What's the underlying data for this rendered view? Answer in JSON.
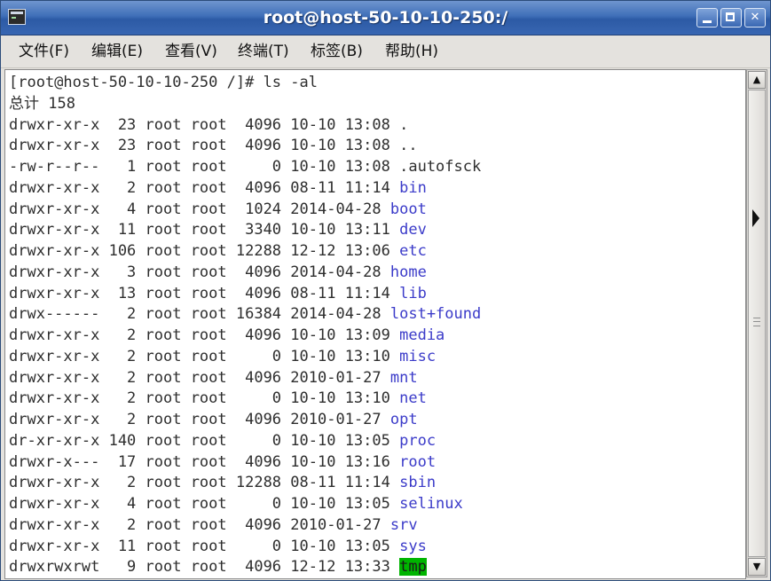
{
  "window": {
    "title": "root@host-50-10-10-250:/"
  },
  "menu": [
    "文件(F)",
    "编辑(E)",
    "查看(V)",
    "终端(T)",
    "标签(B)",
    "帮助(H)"
  ],
  "terminal": {
    "prompt": "[root@host-50-10-10-250 /]# ls -al",
    "total": "总计 158",
    "listing": [
      {
        "perm": "drwxr-xr-x",
        "links": "23",
        "owner": "root",
        "group": "root",
        "size": "4096",
        "date": "10-10 13:08",
        "name": ".",
        "kind": "plain"
      },
      {
        "perm": "drwxr-xr-x",
        "links": "23",
        "owner": "root",
        "group": "root",
        "size": "4096",
        "date": "10-10 13:08",
        "name": "..",
        "kind": "plain"
      },
      {
        "perm": "-rw-r--r--",
        "links": "1",
        "owner": "root",
        "group": "root",
        "size": "0",
        "date": "10-10 13:08",
        "name": ".autofsck",
        "kind": "plain"
      },
      {
        "perm": "drwxr-xr-x",
        "links": "2",
        "owner": "root",
        "group": "root",
        "size": "4096",
        "date": "08-11 11:14",
        "name": "bin",
        "kind": "dir"
      },
      {
        "perm": "drwxr-xr-x",
        "links": "4",
        "owner": "root",
        "group": "root",
        "size": "1024",
        "date": "2014-04-28",
        "name": "boot",
        "kind": "dir"
      },
      {
        "perm": "drwxr-xr-x",
        "links": "11",
        "owner": "root",
        "group": "root",
        "size": "3340",
        "date": "10-10 13:11",
        "name": "dev",
        "kind": "dir"
      },
      {
        "perm": "drwxr-xr-x",
        "links": "106",
        "owner": "root",
        "group": "root",
        "size": "12288",
        "date": "12-12 13:06",
        "name": "etc",
        "kind": "dir"
      },
      {
        "perm": "drwxr-xr-x",
        "links": "3",
        "owner": "root",
        "group": "root",
        "size": "4096",
        "date": "2014-04-28",
        "name": "home",
        "kind": "dir"
      },
      {
        "perm": "drwxr-xr-x",
        "links": "13",
        "owner": "root",
        "group": "root",
        "size": "4096",
        "date": "08-11 11:14",
        "name": "lib",
        "kind": "dir"
      },
      {
        "perm": "drwx------",
        "links": "2",
        "owner": "root",
        "group": "root",
        "size": "16384",
        "date": "2014-04-28",
        "name": "lost+found",
        "kind": "dir"
      },
      {
        "perm": "drwxr-xr-x",
        "links": "2",
        "owner": "root",
        "group": "root",
        "size": "4096",
        "date": "10-10 13:09",
        "name": "media",
        "kind": "dir"
      },
      {
        "perm": "drwxr-xr-x",
        "links": "2",
        "owner": "root",
        "group": "root",
        "size": "0",
        "date": "10-10 13:10",
        "name": "misc",
        "kind": "dir"
      },
      {
        "perm": "drwxr-xr-x",
        "links": "2",
        "owner": "root",
        "group": "root",
        "size": "4096",
        "date": "2010-01-27",
        "name": "mnt",
        "kind": "dir"
      },
      {
        "perm": "drwxr-xr-x",
        "links": "2",
        "owner": "root",
        "group": "root",
        "size": "0",
        "date": "10-10 13:10",
        "name": "net",
        "kind": "dir"
      },
      {
        "perm": "drwxr-xr-x",
        "links": "2",
        "owner": "root",
        "group": "root",
        "size": "4096",
        "date": "2010-01-27",
        "name": "opt",
        "kind": "dir"
      },
      {
        "perm": "dr-xr-xr-x",
        "links": "140",
        "owner": "root",
        "group": "root",
        "size": "0",
        "date": "10-10 13:05",
        "name": "proc",
        "kind": "dir"
      },
      {
        "perm": "drwxr-x---",
        "links": "17",
        "owner": "root",
        "group": "root",
        "size": "4096",
        "date": "10-10 13:16",
        "name": "root",
        "kind": "dir"
      },
      {
        "perm": "drwxr-xr-x",
        "links": "2",
        "owner": "root",
        "group": "root",
        "size": "12288",
        "date": "08-11 11:14",
        "name": "sbin",
        "kind": "dir"
      },
      {
        "perm": "drwxr-xr-x",
        "links": "4",
        "owner": "root",
        "group": "root",
        "size": "0",
        "date": "10-10 13:05",
        "name": "selinux",
        "kind": "dir"
      },
      {
        "perm": "drwxr-xr-x",
        "links": "2",
        "owner": "root",
        "group": "root",
        "size": "4096",
        "date": "2010-01-27",
        "name": "srv",
        "kind": "dir"
      },
      {
        "perm": "drwxr-xr-x",
        "links": "11",
        "owner": "root",
        "group": "root",
        "size": "0",
        "date": "10-10 13:05",
        "name": "sys",
        "kind": "dir"
      },
      {
        "perm": "drwxrwxrwt",
        "links": "9",
        "owner": "root",
        "group": "root",
        "size": "4096",
        "date": "12-12 13:33",
        "name": "tmp",
        "kind": "sticky"
      }
    ]
  },
  "colors": {
    "directory": "#3b3bc9",
    "sticky_background": "#00b400",
    "titlebar": "#3f6fb8"
  },
  "icons": {
    "app": "terminal-icon",
    "minimize": "minimize-icon",
    "maximize": "maximize-icon",
    "close": "close-icon",
    "scroll_up": "arrow-up-icon",
    "scroll_down": "arrow-down-icon",
    "pointer": "mouse-pointer-icon"
  },
  "window_controls": {
    "close_glyph": "✕"
  },
  "scrollbar": {
    "up_glyph": "▲",
    "down_glyph": "▼"
  }
}
